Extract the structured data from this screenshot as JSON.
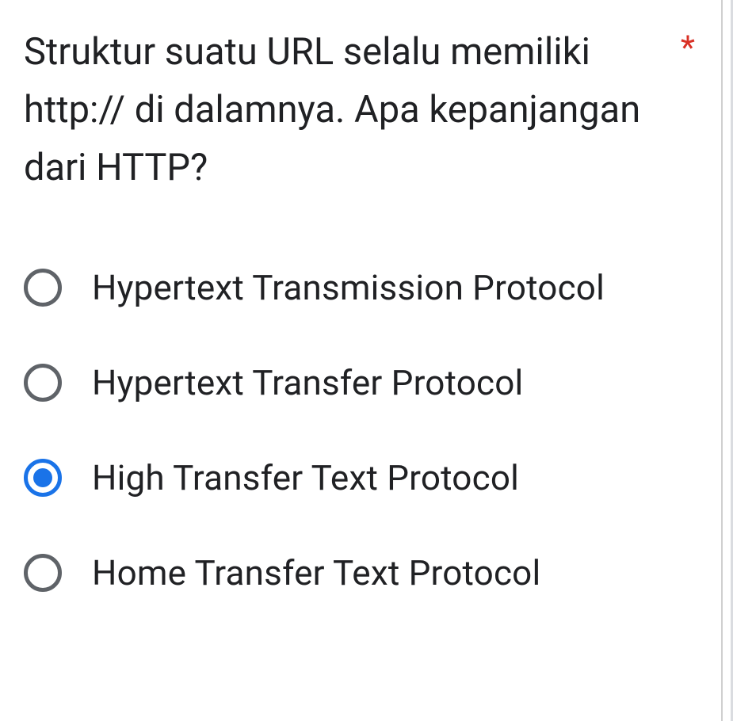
{
  "question": {
    "text": "Struktur suatu URL selalu memiliki http:// di dalamnya. Apa kepanjangan dari HTTP?",
    "required_marker": "*"
  },
  "options": [
    {
      "label": "Hypertext Transmission Protocol",
      "selected": false
    },
    {
      "label": "Hypertext Transfer Protocol",
      "selected": false
    },
    {
      "label": "High Transfer Text Protocol",
      "selected": true
    },
    {
      "label": "Home Transfer Text Protocol",
      "selected": false
    }
  ]
}
